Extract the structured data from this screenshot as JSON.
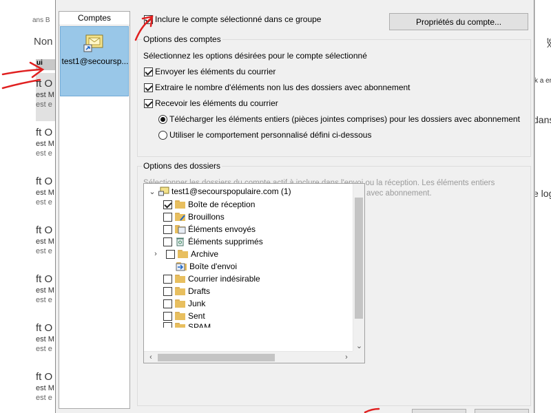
{
  "background": {
    "left_sub": "ans B",
    "left_big": "Non",
    "left_selected_bar": "ui",
    "mail_items": [
      {
        "l1": "ft O",
        "l2": "est M",
        "l3": "est e"
      },
      {
        "l1": "ft O",
        "l2": "est M",
        "l3": "est e"
      },
      {
        "l1": "ft O",
        "l2": "est M",
        "l3": "est e"
      },
      {
        "l1": "ft O",
        "l2": "est M",
        "l3": "est e"
      },
      {
        "l1": "ft O",
        "l2": "est M",
        "l3": "est e"
      },
      {
        "l1": "ft O",
        "l2": "est M",
        "l3": "est e"
      }
    ],
    "right_texts": [
      "te",
      "X",
      "k a er",
      "dans",
      "e log"
    ]
  },
  "accounts_panel": {
    "header": "Comptes",
    "account_label": "test1@secoursp..."
  },
  "include_account": {
    "label": "Inclure le compte sélectionné dans ce groupe",
    "checked": true
  },
  "properties_button": "Propriétés du compte...",
  "account_options": {
    "legend": "Options des comptes",
    "description": "Sélectionnez les options désirées pour le compte sélectionné",
    "send_mail": {
      "label": "Envoyer les éléments du courrier",
      "checked": true
    },
    "unread_count": {
      "label": "Extraire le nombre d'éléments non lus des dossiers avec abonnement",
      "checked": true
    },
    "receive_mail": {
      "label": "Recevoir les éléments du courrier",
      "checked": true
    },
    "download_full": {
      "label": "Télécharger les éléments entiers (pièces jointes comprises) pour les dossiers avec abonnement",
      "selected": true
    },
    "custom_behavior": {
      "label": "Utiliser le comportement personnalisé défini ci-dessous",
      "selected": false
    }
  },
  "folder_options": {
    "legend": "Options des dossiers",
    "hint": "Sélectionner les dossiers du compte actif à inclure dans l'envoi ou la réception. Les éléments entiers (pièces jointes comprises) seront téléchargés pour les dossiers avec abonnement.",
    "tree": {
      "root_label": "test1@secourspopulaire.com (1)",
      "folders": [
        {
          "label": "Boîte de réception",
          "checked": true
        },
        {
          "label": "Brouillons",
          "checked": false
        },
        {
          "label": "Éléments envoyés",
          "checked": false
        },
        {
          "label": "Éléments supprimés",
          "checked": false
        },
        {
          "label": "Archive",
          "checked": false
        },
        {
          "label": "Boîte d'envoi",
          "checked": null
        },
        {
          "label": "Courrier indésirable",
          "checked": false
        },
        {
          "label": "Drafts",
          "checked": false
        },
        {
          "label": "Junk",
          "checked": false
        },
        {
          "label": "Sent",
          "checked": false
        },
        {
          "label": "SPAM",
          "checked": false
        }
      ]
    }
  },
  "colors": {
    "accent_selection": "#99c7e8",
    "annotation": "#e02020"
  }
}
